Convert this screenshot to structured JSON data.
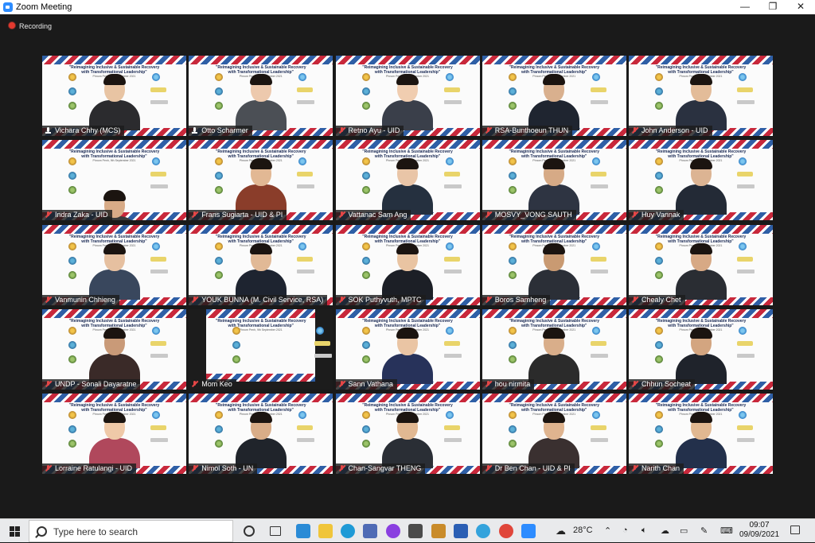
{
  "window": {
    "title": "Zoom Meeting",
    "controls": {
      "minimize": "—",
      "restore": "❐",
      "close": "✕"
    }
  },
  "recording": {
    "label": "Recording",
    "icon": "record-dot-icon"
  },
  "backdrop": {
    "line1": "\"Reimagining Inclusive & Sustainable Recovery",
    "line2": "with Transformational Leadership\"",
    "line3": "Phnom Penh, 9th September 2021"
  },
  "participants": [
    {
      "name": "Vichara Chhy (MCS)",
      "muted": false,
      "active": true
    },
    {
      "name": "Otto Scharmer",
      "muted": false,
      "active": false
    },
    {
      "name": "Retno Ayu - UID",
      "muted": true,
      "active": false
    },
    {
      "name": "RSA-Bunthoeun THUN",
      "muted": true,
      "active": false
    },
    {
      "name": "John Anderson - UID",
      "muted": true,
      "active": false
    },
    {
      "name": "Indra Zaka - UID",
      "muted": true,
      "active": false
    },
    {
      "name": "Frans Sugiarta - UID & PI",
      "muted": true,
      "active": false
    },
    {
      "name": "Vattanac Sam Ang",
      "muted": true,
      "active": false
    },
    {
      "name": "MOSVY_VONG SAUTH",
      "muted": true,
      "active": false
    },
    {
      "name": "Huy Vannak",
      "muted": true,
      "active": false
    },
    {
      "name": "Vanmunin Chhieng",
      "muted": true,
      "active": false
    },
    {
      "name": "YOUK BUNNA   (M. Civil Service, RSA)",
      "muted": true,
      "active": false
    },
    {
      "name": "SOK Puthyvuth, MPTC",
      "muted": true,
      "active": false
    },
    {
      "name": "Boros Samheng",
      "muted": true,
      "active": false
    },
    {
      "name": "Chealy Chet",
      "muted": true,
      "active": false
    },
    {
      "name": "UNDP - Sonali Dayaratne",
      "muted": true,
      "active": false
    },
    {
      "name": "Mom Keo",
      "muted": true,
      "active": false
    },
    {
      "name": "Sann Vathana",
      "muted": true,
      "active": false
    },
    {
      "name": "hou nirmita",
      "muted": true,
      "active": false
    },
    {
      "name": "Chhun Socheat",
      "muted": true,
      "active": false
    },
    {
      "name": "Lorraine Ratulangi - UID",
      "muted": true,
      "active": false
    },
    {
      "name": "Nimol Soth - UN",
      "muted": true,
      "active": false
    },
    {
      "name": "Chan-Sangvar THENG",
      "muted": true,
      "active": false
    },
    {
      "name": "Dr Ben Chan - UID & PI",
      "muted": true,
      "active": false
    },
    {
      "name": "Narith Chan",
      "muted": true,
      "active": false
    }
  ],
  "taskbar": {
    "search_placeholder": "Type here to search",
    "pinned": [
      {
        "name": "cortana-icon",
        "color": "#ffffff"
      },
      {
        "name": "task-view-icon",
        "color": "#ffffff"
      },
      {
        "name": "store-app-icon",
        "color": "#2a8bd6"
      },
      {
        "name": "file-explorer-icon",
        "color": "#f0c53a"
      },
      {
        "name": "edge-icon",
        "color": "#1f9ad6"
      },
      {
        "name": "microsoft-store-icon",
        "color": "#4f6bb5"
      },
      {
        "name": "messenger-icon",
        "color": "#8a3fe0"
      },
      {
        "name": "calculator-icon",
        "color": "#4b4b4b"
      },
      {
        "name": "archive-app-icon",
        "color": "#c98b2a"
      },
      {
        "name": "word-icon",
        "color": "#2b5fb4"
      },
      {
        "name": "telegram-icon",
        "color": "#34a3dc"
      },
      {
        "name": "chrome-icon",
        "color": "#e0463a"
      },
      {
        "name": "zoom-icon",
        "color": "#2d8cff"
      }
    ],
    "weather": "28°C",
    "time": "09:07",
    "date": "09/09/2021"
  }
}
